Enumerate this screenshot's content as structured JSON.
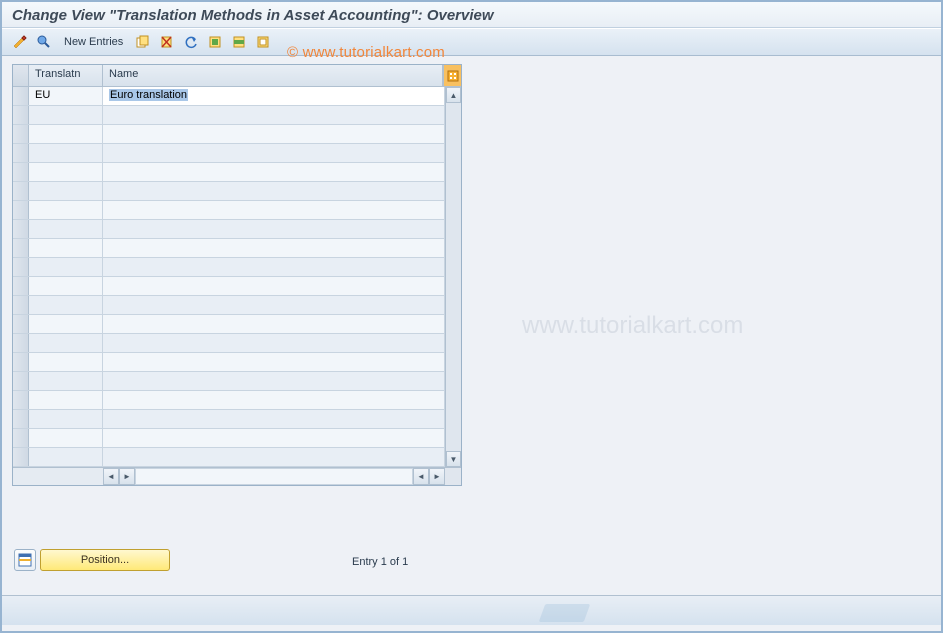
{
  "header": {
    "title": "Change View \"Translation Methods in Asset Accounting\": Overview"
  },
  "toolbar": {
    "new_entries_label": "New Entries"
  },
  "table": {
    "columns": {
      "col1": "Translatn",
      "col2": "Name"
    },
    "rows": [
      {
        "translatn": "EU",
        "name": "Euro translation"
      }
    ]
  },
  "footer": {
    "position_label": "Position...",
    "entry_status": "Entry 1 of 1"
  },
  "watermark": {
    "small": "© www.tutorialkart.com",
    "large": "www.tutorialkart.com"
  }
}
